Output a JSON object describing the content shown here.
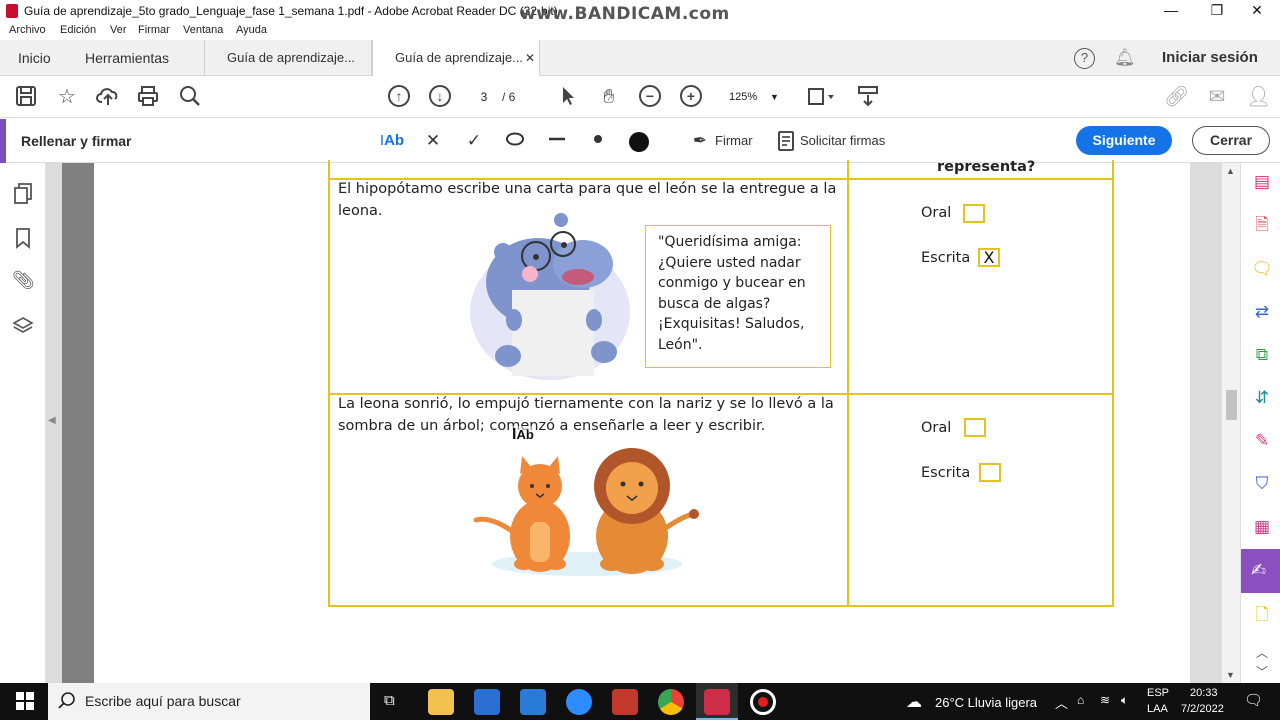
{
  "window": {
    "title": "Guía de aprendizaje_5to grado_Lenguaje_fase 1_semana 1.pdf - Adobe Acrobat Reader DC (32-bit)",
    "watermark": "www.BANDICAM.com"
  },
  "menu": [
    "Archivo",
    "Edición",
    "Ver",
    "Firmar",
    "Ventana",
    "Ayuda"
  ],
  "tabs": {
    "home": "Inicio",
    "tools": "Herramientas",
    "doc1": "Guía de aprendizaje...",
    "doc2": "Guía de aprendizaje...",
    "signin": "Iniciar sesión"
  },
  "toolbar": {
    "current_page": "3",
    "total_pages": "/ 6",
    "zoom": "125%"
  },
  "fillsign": {
    "title": "Rellenar y firmar",
    "text_tool": "Ab",
    "sign": "Firmar",
    "request": "Solicitar firmas",
    "next": "Siguiente",
    "close": "Cerrar"
  },
  "document": {
    "header_fragment": "representa?",
    "row1_text_line1": "El hipopótamo escribe una carta para que el león se la entregue a la",
    "row1_text_line2": "leona.",
    "letter": [
      "\"Queridísima amiga:",
      "¿Quiere usted nadar",
      "conmigo y bucear en",
      "busca de algas?",
      "¡Exquisitas! Saludos,",
      "León\"."
    ],
    "row2_text_line1": "La leona sonrió, lo empujó tiernamente con la nariz y se lo llevó a la",
    "row2_text_line2": "sombra de un árbol; comenzó a enseñarle a leer y escribir.",
    "option_oral": "Oral",
    "option_written": "Escrita",
    "row1_written_mark": "X",
    "cursor_label": "Ab"
  },
  "taskbar": {
    "search_placeholder": "Escribe aquí para buscar",
    "weather": "26°C  Lluvia ligera",
    "lang1": "ESP",
    "lang2": "LAA",
    "time": "20:33",
    "date": "7/2/2022"
  },
  "colors": {
    "accent_blue": "#1473e6",
    "table_border": "#e6c220",
    "fill_sign_accent": "#7c4dbb"
  }
}
